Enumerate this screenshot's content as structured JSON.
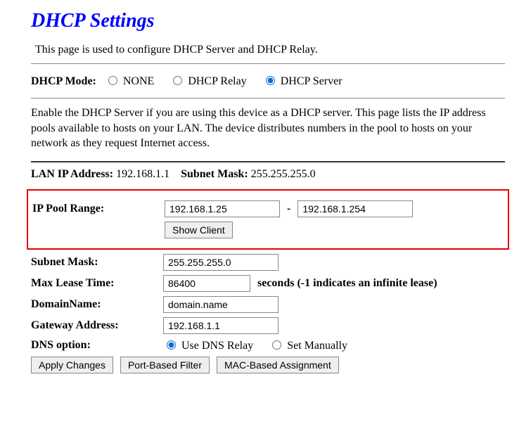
{
  "title": "DHCP Settings",
  "intro": "This page is used to configure DHCP Server and DHCP Relay.",
  "mode": {
    "label": "DHCP Mode:",
    "options": {
      "none": "NONE",
      "relay": "DHCP Relay",
      "server": "DHCP Server"
    }
  },
  "desc": "Enable the DHCP Server if you are using this device as a DHCP server. This page lists the IP address pools available to hosts on your LAN. The device distributes numbers in the pool to hosts on your network as they request Internet access.",
  "lan": {
    "ip_label": "LAN IP Address:",
    "ip_value": "192.168.1.1",
    "mask_label": "Subnet Mask:",
    "mask_value": "255.255.255.0"
  },
  "pool": {
    "label": "IP Pool Range:",
    "start": "192.168.1.25",
    "end": "192.168.1.254",
    "show_client": "Show Client"
  },
  "subnet": {
    "label": "Subnet Mask:",
    "value": "255.255.255.0"
  },
  "lease": {
    "label": "Max Lease Time:",
    "value": "86400",
    "suffix": "seconds (-1 indicates an infinite lease)"
  },
  "domain": {
    "label": "DomainName:",
    "value": "domain.name"
  },
  "gateway": {
    "label": "Gateway Address:",
    "value": "192.168.1.1"
  },
  "dns": {
    "label": "DNS option:",
    "relay": "Use DNS Relay",
    "manual": "Set Manually"
  },
  "buttons": {
    "apply": "Apply Changes",
    "port_filter": "Port-Based Filter",
    "mac_assign": "MAC-Based Assignment"
  }
}
